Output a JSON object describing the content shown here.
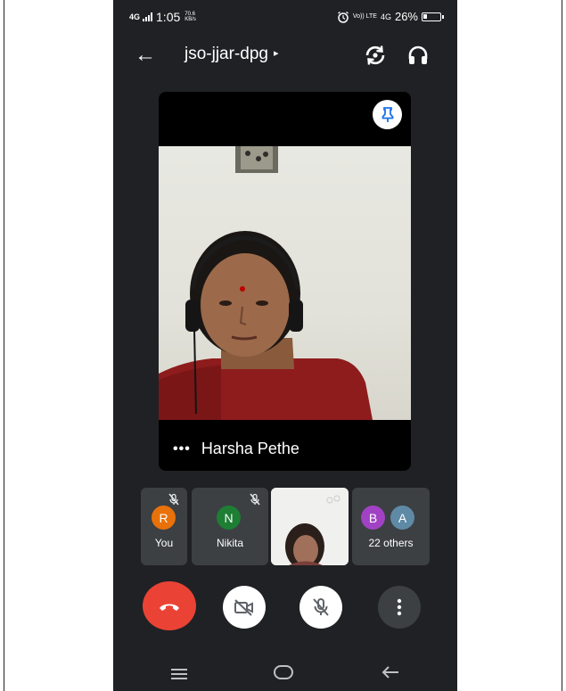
{
  "status_bar": {
    "network": "4G",
    "time": "1:05",
    "speed_value": "70.6",
    "speed_unit": "KB/s",
    "volte": "Vo)) LTE",
    "network2": "4G",
    "battery": "26%",
    "battery_level": 0.26
  },
  "header": {
    "meeting_code": "jso-jjar-dpg",
    "caret": "▸"
  },
  "main_tile": {
    "speaker_name": "Harsha Pethe",
    "more_glyph": "•••"
  },
  "participants": [
    {
      "label": "You",
      "initial": "R",
      "color": "#e8710a",
      "muted": true
    },
    {
      "label": "Nikita",
      "initial": "N",
      "color": "#1e7e34",
      "muted": true
    },
    {
      "label": "",
      "video": true
    },
    {
      "label": "22 others",
      "initials": [
        "B",
        "A"
      ],
      "colors": [
        "#a142c4",
        "#5f8aa6"
      ]
    }
  ],
  "controls": {
    "end_call": "end-call",
    "camera": "camera-off",
    "mic": "mic-off",
    "more": "more"
  },
  "colors": {
    "background": "#202124",
    "end_call": "#ea4335",
    "pin_icon": "#1a73e8"
  }
}
